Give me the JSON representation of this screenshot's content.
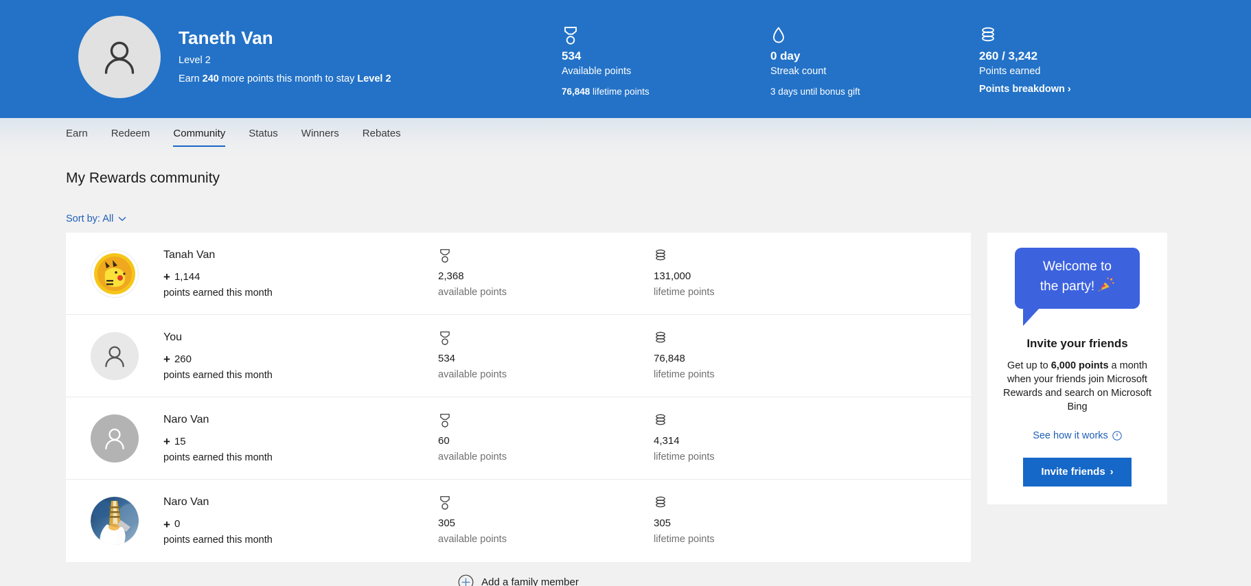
{
  "colors": {
    "hero_blue": "#2372c7",
    "accent_blue": "#1668c8",
    "link_blue": "#1f5eb5",
    "bubble_blue": "#3c62de",
    "page_bg": "#f1f1f1"
  },
  "header": {
    "avatar_icon": "person-icon",
    "name": "Taneth Van",
    "level": "Level 2",
    "sub_prefix": "Earn ",
    "sub_bold": "240",
    "sub_middle": " more points this month to stay ",
    "sub_bold2": "Level 2",
    "stats": [
      {
        "icon": "medal-icon",
        "value": "534",
        "label": "Available points",
        "extra_bold": "76,848",
        "extra_rest": " lifetime points",
        "link": null
      },
      {
        "icon": "flame-icon",
        "value": "0 day",
        "label": "Streak count",
        "extra_bold": "",
        "extra_rest": "3 days until bonus gift",
        "link": null
      },
      {
        "icon": "coins-icon",
        "value": "260 / 3,242",
        "label": "Points earned",
        "extra_bold": "",
        "extra_rest": "",
        "link": "Points breakdown"
      }
    ]
  },
  "nav": {
    "tabs": [
      {
        "label": "Earn",
        "active": false
      },
      {
        "label": "Redeem",
        "active": false
      },
      {
        "label": "Community",
        "active": true
      },
      {
        "label": "Status",
        "active": false
      },
      {
        "label": "Winners",
        "active": false
      },
      {
        "label": "Rebates",
        "active": false
      }
    ]
  },
  "main": {
    "title": "My Rewards community",
    "sort": {
      "label": "Sort by: All",
      "chevron": "chevron-down-icon"
    },
    "column_labels": {
      "available": "available points",
      "lifetime": "lifetime points",
      "earned_caption": "points earned this month"
    },
    "members": [
      {
        "name": "Tanah Van",
        "avatar_kind": "pikachu-coin-photo",
        "delta": "1,144",
        "caption": "points earned this month",
        "available": "2,368",
        "available_label": "available points",
        "lifetime": "131,000",
        "lifetime_label": "lifetime points"
      },
      {
        "name": "You",
        "avatar_kind": "person-light",
        "delta": "260",
        "caption": "points earned this month",
        "available": "534",
        "available_label": "available points",
        "lifetime": "76,848",
        "lifetime_label": "lifetime points"
      },
      {
        "name": "Naro Van",
        "avatar_kind": "person-dark",
        "delta": "15",
        "caption": "points earned this month",
        "available": "60",
        "available_label": "available points",
        "lifetime": "4,314",
        "lifetime_label": "lifetime points"
      },
      {
        "name": "Naro Van",
        "avatar_kind": "shuttle-photo",
        "delta": "0",
        "caption": "points earned this month",
        "available": "305",
        "available_label": "available points",
        "lifetime": "305",
        "lifetime_label": "lifetime points"
      }
    ],
    "add_member": {
      "label": "Add a family member",
      "icon": "plus-circle-icon"
    }
  },
  "side_card": {
    "bubble_line1": "Welcome to",
    "bubble_line2": "the party!",
    "bubble_emoji": "party-popper-icon",
    "title": "Invite your friends",
    "body_1": "Get up to ",
    "body_bold": "6,000 points",
    "body_2": " a month when your friends join Microsoft Rewards and search on Microsoft Bing",
    "link": "See how it works",
    "link_icon": "info-icon",
    "button": "Invite friends",
    "button_chevron": "chevron-right-icon"
  }
}
